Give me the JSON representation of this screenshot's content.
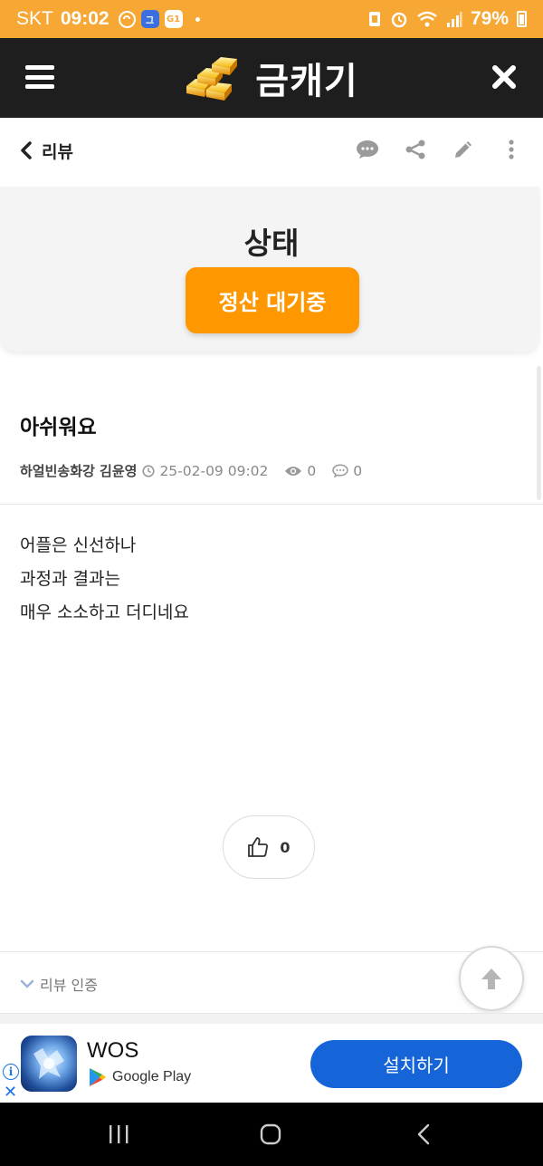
{
  "status_bar": {
    "carrier": "SKT",
    "time": "09:02",
    "icon_badge_1": "그",
    "icon_badge_2": "G1",
    "battery": "79%"
  },
  "app_bar": {
    "title": "금캐기",
    "menu_icon": "hamburger-menu-icon",
    "close_icon": "close-icon",
    "logo_icon": "gold-bars-icon"
  },
  "sub_bar": {
    "back_label": "리뷰",
    "actions": [
      "comment-icon",
      "share-icon",
      "edit-icon",
      "more-icon"
    ]
  },
  "status_card": {
    "title": "상태",
    "button_label": "정산 대기중",
    "button_color": "#ff9800"
  },
  "post": {
    "title": "아쉬워요",
    "author": "하얼빈송화강 김윤영",
    "date": "25-02-09 09:02",
    "views": "0",
    "comments": "0",
    "body_lines": [
      "어플은 신선하나",
      "과정과 결과는",
      "매우 소소하고 더디네요"
    ],
    "likes": "0"
  },
  "review_cert": {
    "label": "리뷰 인증"
  },
  "ad": {
    "app_name": "WOS",
    "store": "Google Play",
    "install_label": "설치하기",
    "install_color": "#1565d8"
  },
  "colors": {
    "status_bar": "#f7a733",
    "app_bar": "#1e1e1e"
  }
}
